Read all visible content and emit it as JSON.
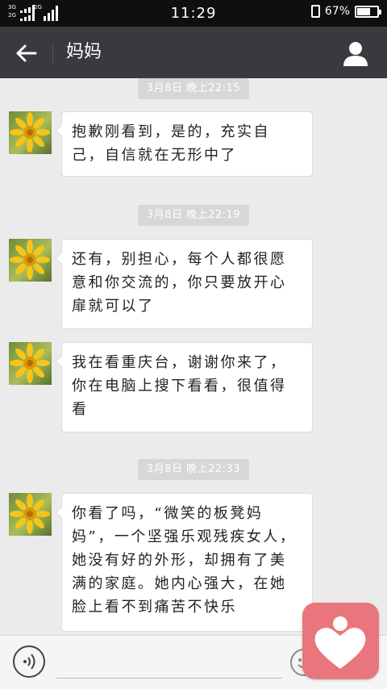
{
  "status_bar": {
    "network_top": "3G",
    "network_bottom": "2G",
    "network_mid": "2G",
    "time": "11:29",
    "battery_percent": "67%",
    "battery_level": 0.67,
    "icons": [
      "signal-icon",
      "vibrate-icon",
      "battery-icon"
    ]
  },
  "title_bar": {
    "title": "妈妈",
    "icons": [
      "back-arrow-icon",
      "contact-profile-icon"
    ]
  },
  "chat": {
    "messages": [
      {
        "timestamp": "3月8日 晚上22:15",
        "text": "抱歉刚看到，是的，充实自己，自信就在无形中了"
      },
      {
        "timestamp": "3月8日 晚上22:19",
        "text": "还有，别担心，每个人都很愿意和你交流的，你只要放开心扉就可以了"
      },
      {
        "timestamp": "",
        "text": "我在看重庆台，谢谢你来了，你在电脑上搜下看看，很值得看"
      },
      {
        "timestamp": "3月8日 晚上22:33",
        "text": "你看了吗，“微笑的板凳妈妈”，一个坚强乐观残疾女人，她没有好的外形，却拥有了美满的家庭。她内心强大，在她脸上看不到痛苦不快乐"
      }
    ],
    "avatar_icon": "sunflower-avatar-icon"
  },
  "input_bar": {
    "icons": [
      "voice-input-icon",
      "emoji-icon",
      "floating-heart-app-icon"
    ]
  },
  "colors": {
    "status_bar_bg": "#0f0f0f",
    "title_bar_bg": "#3a3a3e",
    "chat_bg": "#ebebeb",
    "timestamp_bg": "#d7d7d7",
    "bubble_bg": "#ffffff",
    "float_app_bg": "#e8767c"
  }
}
